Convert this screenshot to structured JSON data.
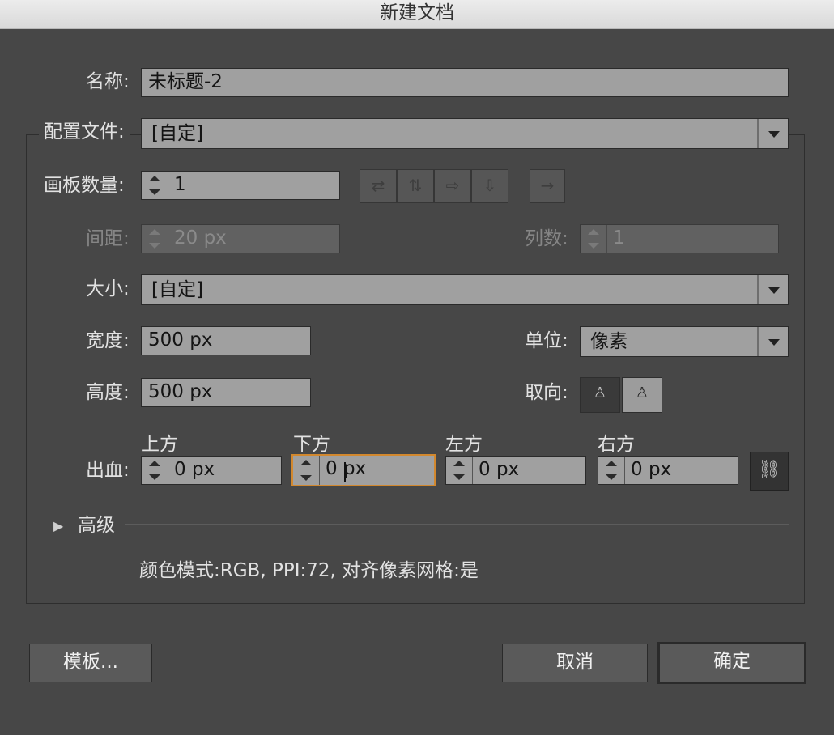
{
  "window": {
    "title": "新建文档"
  },
  "form": {
    "name_label": "名称:",
    "name_value": "未标题-2",
    "profile_label": "配置文件:",
    "profile_value": "[自定]",
    "artboards_label": "画板数量:",
    "artboards_value": "1",
    "spacing_label": "间距:",
    "spacing_value": "20 px",
    "columns_label": "列数:",
    "columns_value": "1",
    "size_label": "大小:",
    "size_value": "[自定]",
    "width_label": "宽度:",
    "width_value": "500 px",
    "units_label": "单位:",
    "units_value": "像素",
    "height_label": "高度:",
    "height_value": "500 px",
    "orientation_label": "取向:",
    "bleed_label": "出血:",
    "bleed": {
      "top_label": "上方",
      "top_value": "0 px",
      "bottom_label": "下方",
      "bottom_value": "0 px",
      "left_label": "左方",
      "left_value": "0 px",
      "right_label": "右方",
      "right_value": "0 px"
    },
    "advanced_label": "高级",
    "summary": "颜色模式:RGB, PPI:72, 对齐像素网格:是"
  },
  "icons": {
    "grid_by_row": "⇄",
    "grid_by_column": "⇅",
    "arrange_by_row": "⇨",
    "arrange_by_column": "⇩",
    "right_to_left": "→",
    "portrait": "♙",
    "landscape": "♙",
    "link": "⛓",
    "disclosure": "▶"
  },
  "buttons": {
    "templates": "模板...",
    "cancel": "取消",
    "ok": "确定"
  },
  "colors": {
    "focus_ring": "#d2882e",
    "dialog_bg": "#474747",
    "field_bg": "#a0a0a0"
  }
}
